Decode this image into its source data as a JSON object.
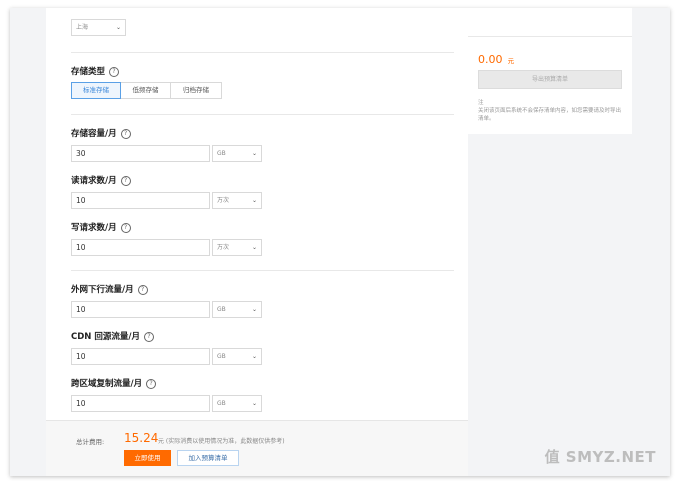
{
  "region": {
    "value": "上海"
  },
  "storage_type": {
    "label": "存储类型",
    "options": [
      "标准存储",
      "低频存储",
      "归档存储"
    ],
    "selected_index": 0
  },
  "fields": [
    {
      "label": "存储容量/月",
      "value": "30",
      "unit": "GB"
    },
    {
      "label": "读请求数/月",
      "value": "10",
      "unit": "万次"
    },
    {
      "label": "写请求数/月",
      "value": "10",
      "unit": "万次"
    },
    {
      "label": "外网下行流量/月",
      "value": "10",
      "unit": "GB"
    },
    {
      "label": "CDN 回源流量/月",
      "value": "10",
      "unit": "GB"
    },
    {
      "label": "跨区域复制流量/月",
      "value": "10",
      "unit": "GB"
    }
  ],
  "footer": {
    "total_label": "总计费用:",
    "total_value": "15.24",
    "total_note": "元 (实际消费以使用情况为准，此数据仅供参考)",
    "buy_label": "立即使用",
    "add_label": "加入预算清单"
  },
  "sidebar": {
    "amount": "0.00",
    "amount_unit": "元",
    "export_label": "导出预算清单",
    "note_title": "注",
    "note_text": "关闭该页面后系统不会保存清单内容，如您需要请及时导出清单。"
  },
  "watermark": "值 SMYZ.NET",
  "colors": {
    "accent": "#ff6a00",
    "primary": "#3a86d8"
  }
}
